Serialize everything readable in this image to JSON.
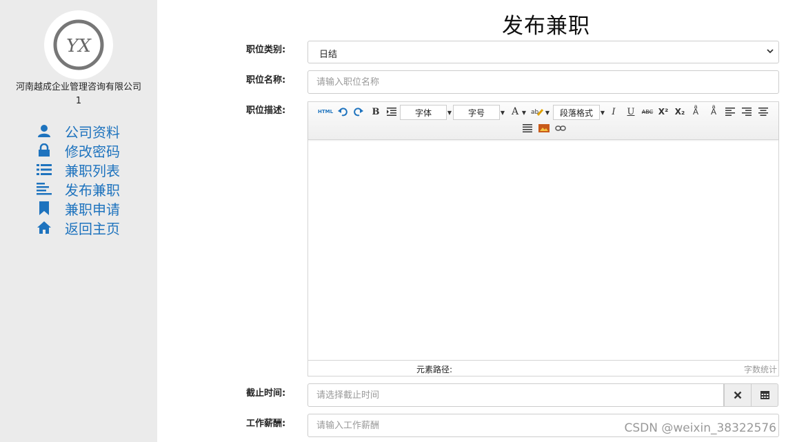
{
  "sidebar": {
    "company_name": "河南越成企业管理咨询有限公司",
    "company_sub": "1",
    "logo_text": "YX",
    "items": [
      {
        "label": "公司资料",
        "icon": "user-icon"
      },
      {
        "label": "修改密码",
        "icon": "lock-icon"
      },
      {
        "label": "兼职列表",
        "icon": "list-icon"
      },
      {
        "label": "发布兼职",
        "icon": "align-left-icon"
      },
      {
        "label": "兼职申请",
        "icon": "bookmark-icon"
      },
      {
        "label": "返回主页",
        "icon": "home-icon"
      }
    ],
    "accent": "#1e73be"
  },
  "page": {
    "title": "发布兼职"
  },
  "form": {
    "category_label": "职位类别:",
    "category_value": "日结",
    "name_label": "职位名称:",
    "name_placeholder": "请输入职位名称",
    "desc_label": "职位描述:",
    "deadline_label": "截止时间:",
    "deadline_placeholder": "请选择截止时间",
    "salary_label": "工作薪酬:",
    "salary_placeholder": "请输入工作薪酬"
  },
  "editor": {
    "html_label": "HTML",
    "font_combo": "字体",
    "size_combo": "字号",
    "paragraph_combo": "段落格式",
    "path_label": "元素路径:",
    "wordcount_label": "字数统计"
  },
  "watermark": "CSDN @weixin_38322576"
}
